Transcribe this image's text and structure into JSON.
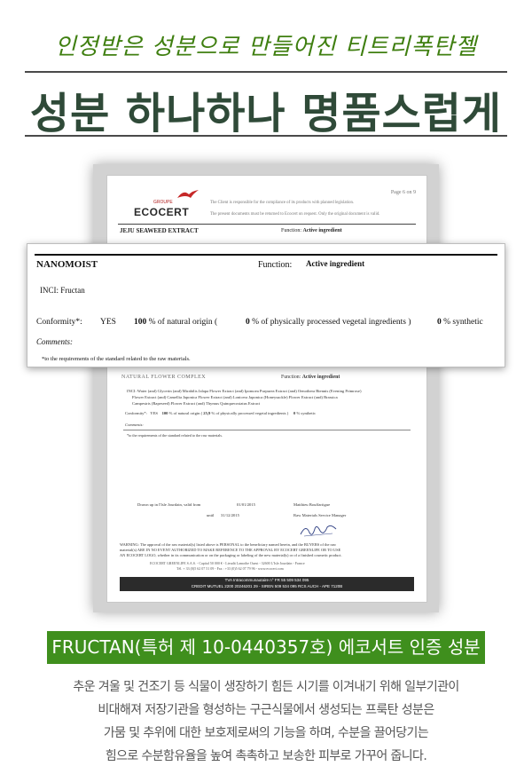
{
  "header": {
    "subtitle": "인정받은 성분으로 만들어진 티트리폭탄젤",
    "title": "성분 하나하나 명품스럽게"
  },
  "certificate": {
    "logo": {
      "brand": "ECOCERT",
      "group": "GROUPE"
    },
    "page_number": "Page 6 on 9",
    "notice_1": "The Client is responsible for the compliance of its products with planned legislation.",
    "notice_2": "The present documents must be returned to Ecocert on request. Only the original document is valid.",
    "top_product": "JEJU SEAWEED EXTRACT",
    "function_label": "Function:",
    "function_value": "Active ingredient",
    "nanomoist": {
      "name": "NANOMOIST",
      "function_label": "Function:",
      "function_value": "Active ingredient",
      "inci": "INCI:  Fructan",
      "conformity_label": "Conformity*:",
      "conformity_value": "YES",
      "natural_origin_pct": "100",
      "natural_origin_text": "% of natural origin  (",
      "processed_pct": "0",
      "processed_text": "% of physically processed vegetal ingredients )",
      "synthetic_pct": "0",
      "synthetic_text": "% synthetic",
      "comments_label": "Comments:",
      "footnote": "*to the requirements of the standard related to the raw materials."
    },
    "lower": {
      "product": "NATURAL FLOWER COMPLEX",
      "function_label": "Function:",
      "function_value": "Active ingredient",
      "inci_line_1": "INCI:  Water (and) Glycerin (and) Mirabilis Jalapa Flower Extract (and) Ipomoea Purpurea Extract (and) Oenothera Biennis (Evening Primrose)",
      "inci_line_2": "Flower Extract (and) Camellia Japonica Flower Extract (and) Lonicera Japonica (Honeysuckle) Flower Extract (and) Brassica",
      "inci_line_3": "Campestris (Rapeseed) Flower Extract (and) Thymus Quinquecostatus Extract",
      "conformity_label": "Conformity*:",
      "conformity_value": "YES",
      "natural_origin": "100",
      "natural_origin_text": "% of natural origin  (",
      "processed": "25,9",
      "processed_text": "% of physically processed vegetal ingredients )",
      "synthetic": "0",
      "synthetic_text": "% synthetic",
      "comments_label": "Comments:",
      "footnote": "*to the requirements of the standard related to the raw materials.",
      "drawn_up": "Drawn up in l'Isle Jourdain, valid from",
      "valid_from": "01/01/2015",
      "until_label": "until",
      "valid_until": "31/12/2015",
      "signatory": "Matthieu Bouffartigue",
      "signatory_title": "Raw Materials Service Manager",
      "warning_1": "WARNING: The approval of the raw material(s) listed above is PERSONAL to the beneficiary named herein, and the BUYERS of the raw",
      "warning_2": "material(s) ARE IN NO EVENT AUTHORIZED TO MAKE REFERENCE TO THE APPROVAL BY ECOCERT GREENLIFE OR TO USE",
      "warning_3": "AN ECOCERT LOGO, whether in its communication or on the packaging or labeling of the new material(s) or of a finished cosmetic product.",
      "address_1": "ECOCERT GREENLIFE S.A.S. - Capital 50 000 € - Lieudit Lamothe Ouest - 32600 L'Isle Jourdain - France",
      "address_2": "Tél. + 33 (0)5 62 07 51 09 - Fax : +33 (0)5 62 07 79 96 - www.ecocert.com",
      "bar_1": "TVA Intracommunautaire n° FR 55 509 534 095",
      "bar_2": "CREDIT MUTUEL 2200 20246201 29 - SIREN 509 534 095 RCS AUCH - APE 7120B"
    }
  },
  "badge": "FRUCTAN(특허 제 10-0440357호) 에코서트 인증 성분",
  "description": [
    "추운 겨울 및 건조기 등 식물이 생장하기 힘든 시기를 이겨내기 위해 일부기관이",
    "비대해져 저장기관을 형성하는 구근식물에서 생성되는 프룩탄 성분은",
    "가뭄 및 추위에 대한 보호제로써의 기능을 하며, 수분을 끌어당기는",
    "힘으로 수분함유율을 높여 촉촉하고 보송한 피부로 가꾸어 줍니다."
  ],
  "colors": {
    "accent_green": "#3f8f1d",
    "title_dark_green": "#2f4a38",
    "subtitle_green": "#3f7f10"
  }
}
